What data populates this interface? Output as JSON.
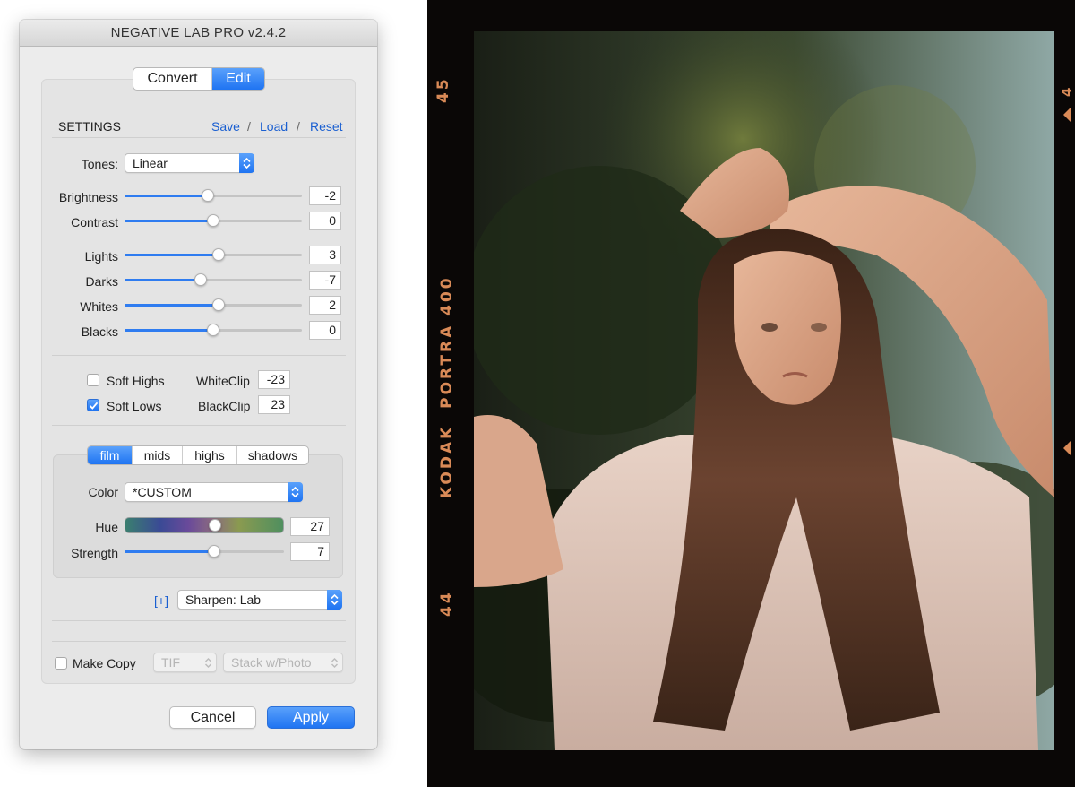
{
  "window": {
    "title": "NEGATIVE LAB PRO v2.4.2"
  },
  "mode_tabs": [
    {
      "label": "Convert",
      "selected": false
    },
    {
      "label": "Edit",
      "selected": true
    }
  ],
  "settings": {
    "heading": "SETTINGS",
    "save": "Save",
    "load": "Load",
    "reset": "Reset",
    "separator": "/"
  },
  "tones": {
    "label": "Tones:",
    "value": "Linear"
  },
  "sliders_basic": [
    {
      "label": "Brightness",
      "value": "-2",
      "level": 0.47
    },
    {
      "label": "Contrast",
      "value": "0",
      "level": 0.5
    }
  ],
  "sliders_tone": [
    {
      "label": "Lights",
      "value": "3",
      "level": 0.53
    },
    {
      "label": "Darks",
      "value": "-7",
      "level": 0.43
    },
    {
      "label": "Whites",
      "value": "2",
      "level": 0.53
    },
    {
      "label": "Blacks",
      "value": "0",
      "level": 0.5
    }
  ],
  "soft_highs": {
    "label": "Soft Highs",
    "checked": false
  },
  "soft_lows": {
    "label": "Soft Lows",
    "checked": true
  },
  "white_clip": {
    "label": "WhiteClip",
    "value": "-23"
  },
  "black_clip": {
    "label": "BlackClip",
    "value": "23"
  },
  "color_tabs": [
    {
      "label": "film",
      "selected": true
    },
    {
      "label": "mids",
      "selected": false
    },
    {
      "label": "highs",
      "selected": false
    },
    {
      "label": "shadows",
      "selected": false
    }
  ],
  "color": {
    "label": "Color",
    "value": "*CUSTOM"
  },
  "hue": {
    "label": "Hue",
    "value": "27",
    "level": 0.57
  },
  "strength": {
    "label": "Strength",
    "value": "7",
    "level": 0.56
  },
  "sharpen": {
    "expand": "[+]",
    "value": "Sharpen: Lab"
  },
  "make_copy": {
    "label": "Make Copy",
    "checked": false,
    "format": "TIF",
    "stack": "Stack w/Photo"
  },
  "buttons": {
    "cancel": "Cancel",
    "apply": "Apply"
  },
  "film_edge": {
    "top_number": "45",
    "brand": "KODAK  PORTRA 400",
    "bottom_number": "44",
    "right_number": "4"
  },
  "colors": {
    "accent": "#2f7cf0",
    "edge_text": "#d98a57"
  },
  "icons": [
    "popup-arrows-icon",
    "checkmark-icon",
    "film-arrow-icon"
  ]
}
